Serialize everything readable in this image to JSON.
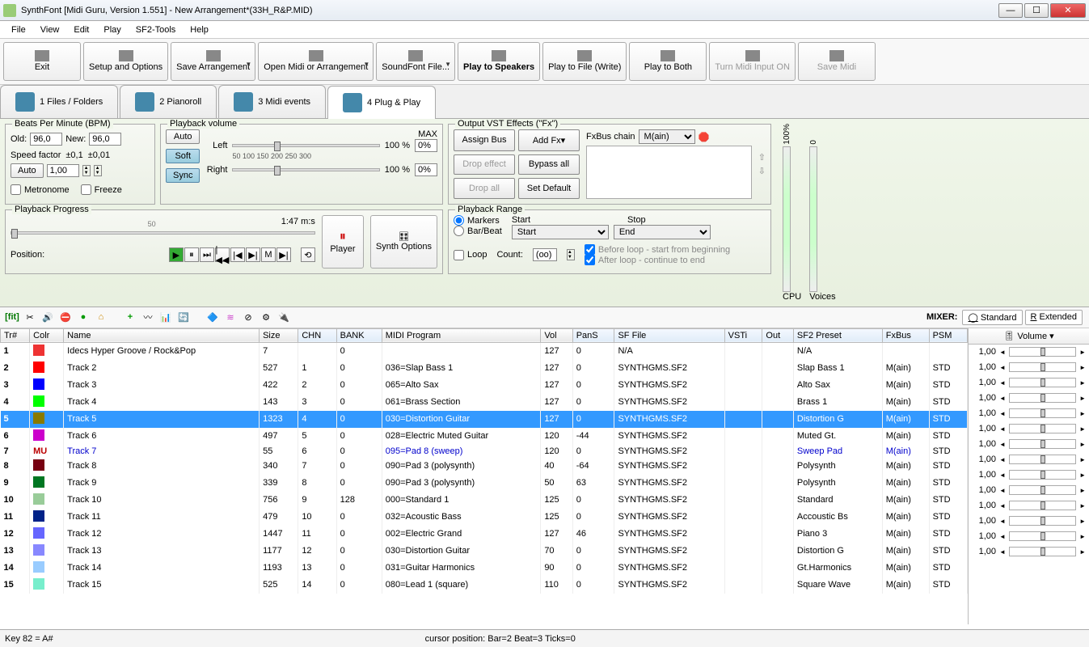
{
  "titlebar": {
    "title": "SynthFont [Midi Guru, Version 1.551] - New Arrangement*(33H_R&P.MID)"
  },
  "menu": [
    "File",
    "View",
    "Edit",
    "Play",
    "SF2-Tools",
    "Help"
  ],
  "toolbar": [
    {
      "label": "Exit",
      "arrow": false
    },
    {
      "label": "Setup and Options",
      "arrow": false
    },
    {
      "label": "Save Arrangement",
      "arrow": true
    },
    {
      "label": "Open Midi or Arrangement",
      "arrow": true
    },
    {
      "label": "SoundFont File...",
      "arrow": true
    },
    {
      "label": "Play to Speakers",
      "bold": true,
      "arrow": false
    },
    {
      "label": "Play to File (Write)",
      "arrow": false
    },
    {
      "label": "Play to Both",
      "arrow": false
    },
    {
      "label": "Turn Midi Input ON",
      "disabled": true,
      "arrow": false
    },
    {
      "label": "Save Midi",
      "disabled": true,
      "arrow": false
    }
  ],
  "tabs": [
    {
      "label": "1 Files / Folders"
    },
    {
      "label": "2 Pianoroll"
    },
    {
      "label": "3 Midi events"
    },
    {
      "label": "4 Plug & Play",
      "active": true
    }
  ],
  "bpm": {
    "title": "Beats Per Minute (BPM)",
    "old_label": "Old:",
    "old": "96,0",
    "new_label": "New:",
    "new": "96,0",
    "speed_label": "Speed factor",
    "pm1": "±0,1",
    "pm2": "±0,01",
    "auto": "Auto",
    "speed": "1,00",
    "metronome": "Metronome",
    "freeze": "Freeze"
  },
  "volume": {
    "title": "Playback volume",
    "auto": "Auto",
    "soft": "Soft",
    "sync": "Sync",
    "left": "Left",
    "right": "Right",
    "max": "MAX",
    "p100": "100 %",
    "p0": "0%",
    "ticks": "50   100   150   200   250   300"
  },
  "vst": {
    "title": "Output VST Effects (\"Fx\")",
    "assign": "Assign Bus",
    "addfx": "Add Fx▾",
    "drop": "Drop effect",
    "bypass": "Bypass all",
    "dropall": "Drop all",
    "setdef": "Set Default",
    "chain_label": "FxBus chain",
    "chain_value": "M(ain)"
  },
  "range": {
    "title": "Playback Range",
    "markers": "Markers",
    "barbeat": "Bar/Beat",
    "start_label": "Start",
    "start": "Start",
    "stop_label": "Stop",
    "stop": "End",
    "loop": "Loop",
    "count_label": "Count:",
    "count": "(oo)",
    "before": "Before loop - start from beginning",
    "after": "After loop - continue to end"
  },
  "progress": {
    "title": "Playback Progress",
    "time": "1:47 m:s",
    "pos": "Position:",
    "synth": "Synth Options",
    "player": "Player"
  },
  "meters": {
    "cpu": "CPU",
    "cpu_v": "100%",
    "voices": "Voices",
    "voices_v": "0"
  },
  "mixer": {
    "label": "MIXER:",
    "std": "Standard",
    "ext": "Extended",
    "vol_hdr": "Volume ▾"
  },
  "columns": [
    "Tr#",
    "Colr",
    "Name",
    "Size",
    "CHN",
    "BANK",
    "MIDI Program",
    "Vol",
    "PanS",
    "SF File",
    "VSTi",
    "Out",
    "SF2 Preset",
    "FxBus",
    "PSM"
  ],
  "tracks": [
    {
      "n": 1,
      "c": "#e33",
      "name": "Idecs Hyper Groove / Rock&Pop",
      "size": 7,
      "chn": "",
      "bank": 0,
      "prog": "",
      "vol": 127,
      "pan": 0,
      "sf": "N/A",
      "preset": "N/A",
      "fx": "",
      "psm": "",
      "mix": ""
    },
    {
      "n": 2,
      "c": "#f00",
      "name": "Track 2",
      "size": 527,
      "chn": 1,
      "bank": 0,
      "prog": "036=Slap Bass 1",
      "vol": 127,
      "pan": 0,
      "sf": "SYNTHGMS.SF2",
      "preset": "Slap Bass 1",
      "fx": "M(ain)",
      "psm": "STD",
      "mix": "1,00"
    },
    {
      "n": 3,
      "c": "#00f",
      "name": "Track 3",
      "size": 422,
      "chn": 2,
      "bank": 0,
      "prog": "065=Alto Sax",
      "vol": 127,
      "pan": 0,
      "sf": "SYNTHGMS.SF2",
      "preset": "Alto Sax",
      "fx": "M(ain)",
      "psm": "STD",
      "mix": "1,00"
    },
    {
      "n": 4,
      "c": "#0f0",
      "name": "Track 4",
      "size": 143,
      "chn": 3,
      "bank": 0,
      "prog": "061=Brass Section",
      "vol": 127,
      "pan": 0,
      "sf": "SYNTHGMS.SF2",
      "preset": "Brass 1",
      "fx": "M(ain)",
      "psm": "STD",
      "mix": "1,00"
    },
    {
      "n": 5,
      "c": "#8a7a00",
      "name": "Track 5",
      "size": 1323,
      "chn": 4,
      "bank": 0,
      "prog": "030=Distortion Guitar",
      "vol": 127,
      "pan": 0,
      "sf": "SYNTHGMS.SF2",
      "preset": "Distortion G",
      "fx": "M(ain)",
      "psm": "STD",
      "mix": "1,00",
      "sel": true
    },
    {
      "n": 6,
      "c": "#c0c",
      "name": "Track 6",
      "size": 497,
      "chn": 5,
      "bank": 0,
      "prog": "028=Electric Muted Guitar",
      "vol": 120,
      "pan": -44,
      "sf": "SYNTHGMS.SF2",
      "preset": "Muted Gt.",
      "fx": "M(ain)",
      "psm": "STD",
      "mix": "1,00"
    },
    {
      "n": 7,
      "c": "#fff",
      "mu": "MU",
      "name": "Track 7",
      "size": 55,
      "chn": 6,
      "bank": 0,
      "prog": "095=Pad 8 (sweep)",
      "vol": 120,
      "pan": 0,
      "sf": "SYNTHGMS.SF2",
      "preset": "Sweep Pad",
      "fx": "M(ain)",
      "psm": "STD",
      "mix": "1,00",
      "blue": true
    },
    {
      "n": 8,
      "c": "#701",
      "name": "Track 8",
      "size": 340,
      "chn": 7,
      "bank": 0,
      "prog": "090=Pad 3 (polysynth)",
      "vol": 40,
      "pan": -64,
      "sf": "SYNTHGMS.SF2",
      "preset": "Polysynth",
      "fx": "M(ain)",
      "psm": "STD",
      "mix": "1,00"
    },
    {
      "n": 9,
      "c": "#072",
      "name": "Track 9",
      "size": 339,
      "chn": 8,
      "bank": 0,
      "prog": "090=Pad 3 (polysynth)",
      "vol": 50,
      "pan": 63,
      "sf": "SYNTHGMS.SF2",
      "preset": "Polysynth",
      "fx": "M(ain)",
      "psm": "STD",
      "mix": "1,00"
    },
    {
      "n": 10,
      "c": "#9c9",
      "name": "Track 10",
      "size": 756,
      "chn": 9,
      "bank": 128,
      "prog": "000=Standard 1",
      "vol": 125,
      "pan": 0,
      "sf": "SYNTHGMS.SF2",
      "preset": "Standard",
      "fx": "M(ain)",
      "psm": "STD",
      "mix": "1,00"
    },
    {
      "n": 11,
      "c": "#028",
      "name": "Track 11",
      "size": 479,
      "chn": 10,
      "bank": 0,
      "prog": "032=Acoustic Bass",
      "vol": 125,
      "pan": 0,
      "sf": "SYNTHGMS.SF2",
      "preset": "Accoustic Bs",
      "fx": "M(ain)",
      "psm": "STD",
      "mix": "1,00"
    },
    {
      "n": 12,
      "c": "#66f",
      "name": "Track 12",
      "size": 1447,
      "chn": 11,
      "bank": 0,
      "prog": "002=Electric Grand",
      "vol": 127,
      "pan": 46,
      "sf": "SYNTHGMS.SF2",
      "preset": "Piano 3",
      "fx": "M(ain)",
      "psm": "STD",
      "mix": "1,00"
    },
    {
      "n": 13,
      "c": "#88f",
      "name": "Track 13",
      "size": 1177,
      "chn": 12,
      "bank": 0,
      "prog": "030=Distortion Guitar",
      "vol": 70,
      "pan": 0,
      "sf": "SYNTHGMS.SF2",
      "preset": "Distortion G",
      "fx": "M(ain)",
      "psm": "STD",
      "mix": "1,00"
    },
    {
      "n": 14,
      "c": "#9cf",
      "name": "Track 14",
      "size": 1193,
      "chn": 13,
      "bank": 0,
      "prog": "031=Guitar Harmonics",
      "vol": 90,
      "pan": 0,
      "sf": "SYNTHGMS.SF2",
      "preset": "Gt.Harmonics",
      "fx": "M(ain)",
      "psm": "STD",
      "mix": "1,00"
    },
    {
      "n": 15,
      "c": "#7ec",
      "name": "Track 15",
      "size": 525,
      "chn": 14,
      "bank": 0,
      "prog": "080=Lead 1 (square)",
      "vol": 110,
      "pan": 0,
      "sf": "SYNTHGMS.SF2",
      "preset": "Square Wave",
      "fx": "M(ain)",
      "psm": "STD",
      "mix": "1,00"
    }
  ],
  "status": {
    "key": "Key 82 = A#",
    "cursor": "cursor position: Bar=2 Beat=3 Ticks=0"
  }
}
